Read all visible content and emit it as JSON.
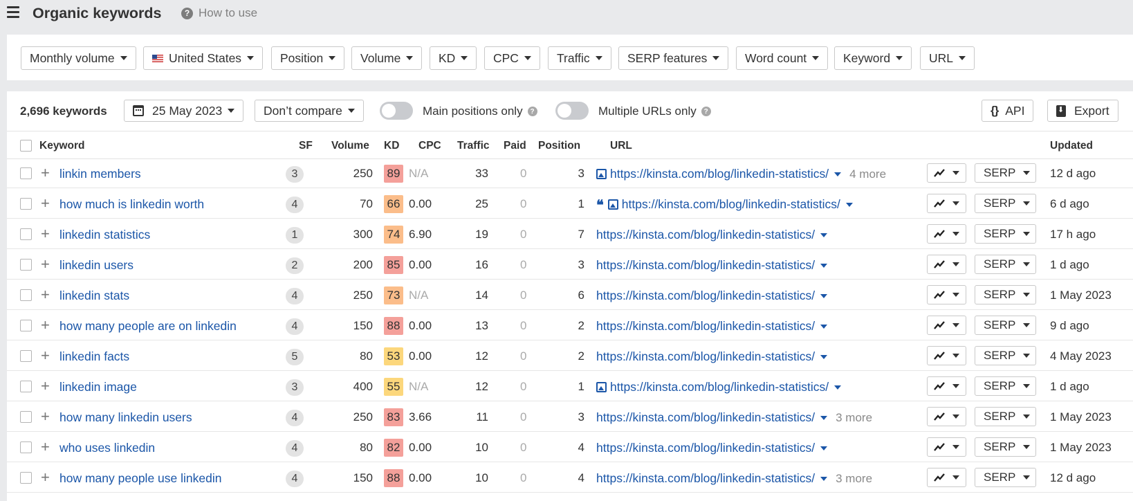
{
  "header": {
    "title": "Organic keywords",
    "how_to_use": "How to use"
  },
  "filters": [
    {
      "label": "Monthly volume",
      "name": "monthly-volume"
    },
    {
      "label": "United States",
      "name": "country"
    },
    {
      "label": "Position",
      "name": "position"
    },
    {
      "label": "Volume",
      "name": "volume"
    },
    {
      "label": "KD",
      "name": "kd"
    },
    {
      "label": "CPC",
      "name": "cpc"
    },
    {
      "label": "Traffic",
      "name": "traffic"
    },
    {
      "label": "SERP features",
      "name": "serp-features"
    },
    {
      "label": "Word count",
      "name": "word-count"
    },
    {
      "label": "Keyword",
      "name": "keyword"
    },
    {
      "label": "URL",
      "name": "url"
    }
  ],
  "toolbar": {
    "count": "2,696 keywords",
    "date": "25 May 2023",
    "compare": "Don’t compare",
    "main_positions": "Main positions only",
    "multiple_urls": "Multiple URLs only",
    "api": "API",
    "export": "Export"
  },
  "columns": {
    "keyword": "Keyword",
    "sf": "SF",
    "volume": "Volume",
    "kd": "KD",
    "cpc": "CPC",
    "traffic": "Traffic",
    "paid": "Paid",
    "position": "Position",
    "url": "URL",
    "updated": "Updated"
  },
  "row_controls": {
    "serp_label": "SERP"
  },
  "kd_colors": {
    "red": "#f4a09a",
    "orange": "#fbbd8a",
    "yellow": "#fcd77c"
  },
  "rows": [
    {
      "keyword": "linkin members",
      "sf": "3",
      "volume": "250",
      "kd": "89",
      "kd_color": "red",
      "cpc": "N/A",
      "traffic": "33",
      "paid": "0",
      "position": "3",
      "url": "https://kinsta.com/blog/linkedin-statistics/",
      "more": "4 more",
      "features": [
        "image"
      ],
      "updated": "12 d ago"
    },
    {
      "keyword": "how much is linkedin worth",
      "sf": "4",
      "volume": "70",
      "kd": "66",
      "kd_color": "orange",
      "cpc": "0.00",
      "traffic": "25",
      "paid": "0",
      "position": "1",
      "url": "https://kinsta.com/blog/linkedin-statistics/",
      "more": "",
      "features": [
        "quote",
        "image"
      ],
      "updated": "6 d ago"
    },
    {
      "keyword": "linkedin statistics",
      "sf": "1",
      "volume": "300",
      "kd": "74",
      "kd_color": "orange",
      "cpc": "6.90",
      "traffic": "19",
      "paid": "0",
      "position": "7",
      "url": "https://kinsta.com/blog/linkedin-statistics/",
      "more": "",
      "features": [],
      "updated": "17 h ago"
    },
    {
      "keyword": "linkedin users",
      "sf": "2",
      "volume": "200",
      "kd": "85",
      "kd_color": "red",
      "cpc": "0.00",
      "traffic": "16",
      "paid": "0",
      "position": "3",
      "url": "https://kinsta.com/blog/linkedin-statistics/",
      "more": "",
      "features": [],
      "updated": "1 d ago"
    },
    {
      "keyword": "linkedin stats",
      "sf": "4",
      "volume": "250",
      "kd": "73",
      "kd_color": "orange",
      "cpc": "N/A",
      "traffic": "14",
      "paid": "0",
      "position": "6",
      "url": "https://kinsta.com/blog/linkedin-statistics/",
      "more": "",
      "features": [],
      "updated": "1 May 2023"
    },
    {
      "keyword": "how many people are on linkedin",
      "sf": "4",
      "volume": "150",
      "kd": "88",
      "kd_color": "red",
      "cpc": "0.00",
      "traffic": "13",
      "paid": "0",
      "position": "2",
      "url": "https://kinsta.com/blog/linkedin-statistics/",
      "more": "",
      "features": [],
      "updated": "9 d ago"
    },
    {
      "keyword": "linkedin facts",
      "sf": "5",
      "volume": "80",
      "kd": "53",
      "kd_color": "yellow",
      "cpc": "0.00",
      "traffic": "12",
      "paid": "0",
      "position": "2",
      "url": "https://kinsta.com/blog/linkedin-statistics/",
      "more": "",
      "features": [],
      "updated": "4 May 2023"
    },
    {
      "keyword": "linkedin image",
      "sf": "3",
      "volume": "400",
      "kd": "55",
      "kd_color": "yellow",
      "cpc": "N/A",
      "traffic": "12",
      "paid": "0",
      "position": "1",
      "url": "https://kinsta.com/blog/linkedin-statistics/",
      "more": "",
      "features": [
        "image"
      ],
      "updated": "1 d ago"
    },
    {
      "keyword": "how many linkedin users",
      "sf": "4",
      "volume": "250",
      "kd": "83",
      "kd_color": "red",
      "cpc": "3.66",
      "traffic": "11",
      "paid": "0",
      "position": "3",
      "url": "https://kinsta.com/blog/linkedin-statistics/",
      "more": "3 more",
      "features": [],
      "updated": "1 May 2023"
    },
    {
      "keyword": "who uses linkedin",
      "sf": "4",
      "volume": "80",
      "kd": "82",
      "kd_color": "red",
      "cpc": "0.00",
      "traffic": "10",
      "paid": "0",
      "position": "4",
      "url": "https://kinsta.com/blog/linkedin-statistics/",
      "more": "",
      "features": [],
      "updated": "1 May 2023"
    },
    {
      "keyword": "how many people use linkedin",
      "sf": "4",
      "volume": "150",
      "kd": "88",
      "kd_color": "red",
      "cpc": "0.00",
      "traffic": "10",
      "paid": "0",
      "position": "4",
      "url": "https://kinsta.com/blog/linkedin-statistics/",
      "more": "3 more",
      "features": [],
      "updated": "12 d ago"
    }
  ]
}
